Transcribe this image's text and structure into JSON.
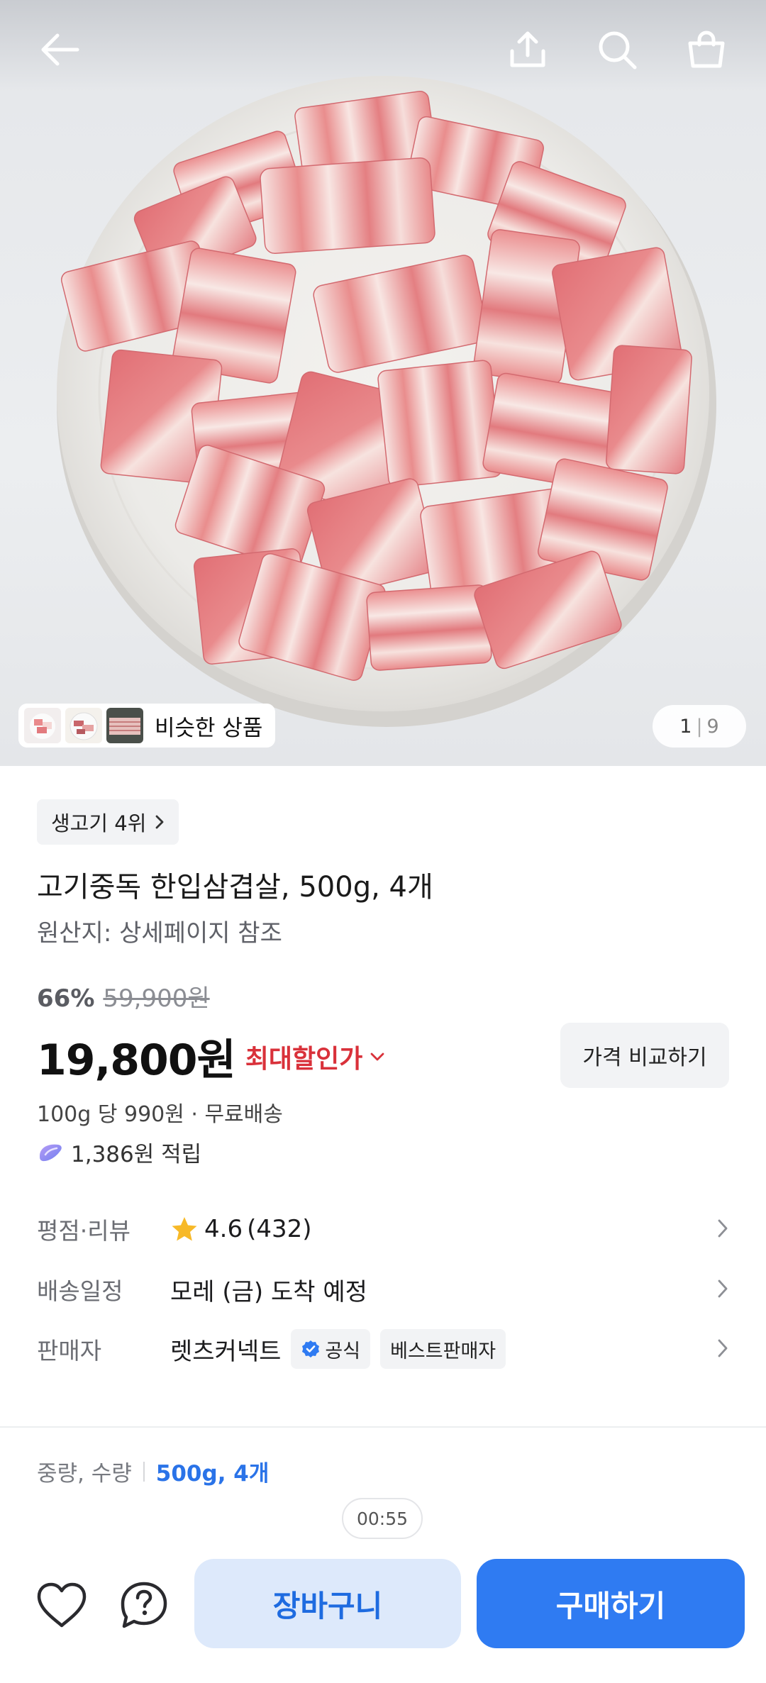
{
  "header": {
    "back_icon": "arrow-left-icon",
    "share_icon": "share-icon",
    "search_icon": "search-icon",
    "cart_icon": "shopping-bag-icon"
  },
  "gallery": {
    "similar_label": "비슷한 상품",
    "current": "1",
    "total": "9"
  },
  "product": {
    "rank_chip": "생고기 4위",
    "title": "고기중독 한입삼겹살, 500g, 4개",
    "origin": "원산지: 상세페이지 참조"
  },
  "pricing": {
    "discount": "66%",
    "original_price": "59,900원",
    "price": "19,800원",
    "best_deal_label": "최대할인가",
    "compare_label": "가격 비교하기",
    "unit_price": "100g 당 990원 · 무료배송",
    "points": "1,386원 적립",
    "colors": {
      "accent_red": "#d9313a",
      "accent_blue": "#2f7bf2"
    }
  },
  "details": {
    "rating_label": "평점·리뷰",
    "rating": "4.6",
    "review_count": "(432)",
    "delivery_label": "배송일정",
    "delivery_value": "모레 (금) 도착 예정",
    "seller_label": "판매자",
    "seller_name": "렛츠커넥트",
    "official_badge": "공식",
    "best_seller_badge": "베스트판매자"
  },
  "options": {
    "label": "중량, 수량",
    "value": "500g, 4개"
  },
  "timer": "00:55",
  "bottom_bar": {
    "wishlist_icon": "heart-icon",
    "help_icon": "question-icon",
    "cart_label": "장바구니",
    "buy_label": "구매하기"
  }
}
